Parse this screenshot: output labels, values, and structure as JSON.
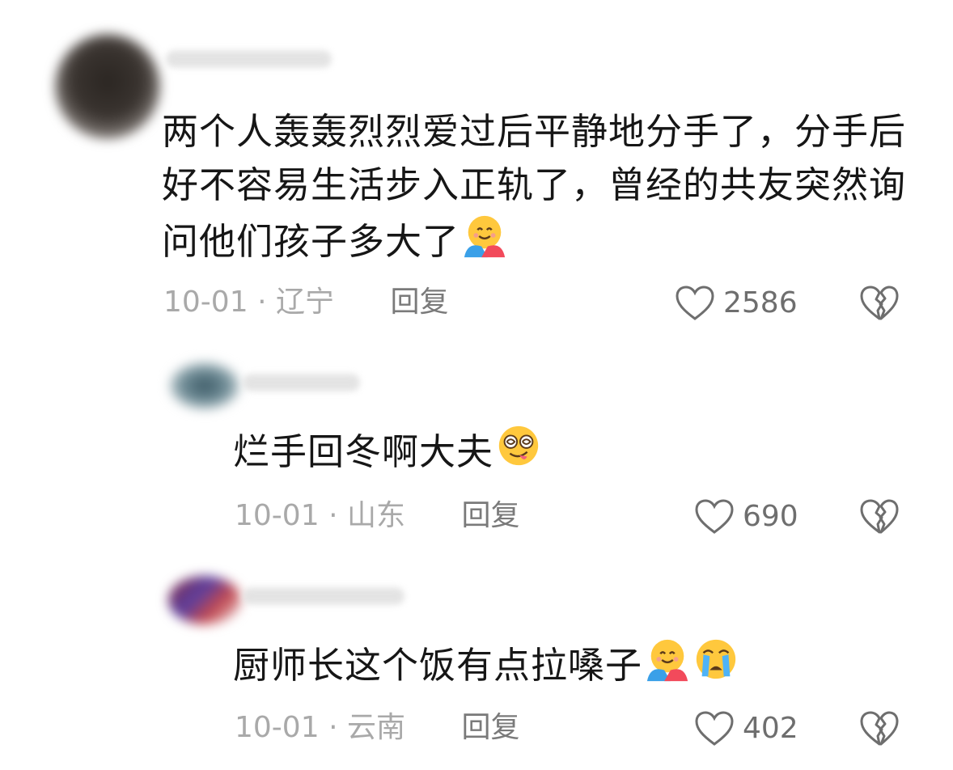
{
  "comments": [
    {
      "text": "两个人轰轰烈烈爱过后平静地分手了，分手后好不容易生活步入正轨了，曾经的共友突然询问他们孩子多大了",
      "emojis": [
        "smiling-face-with-hearts-hugging"
      ],
      "date": "10-01",
      "separator": "·",
      "location": "辽宁",
      "reply_label": "回复",
      "likes": "2586"
    },
    {
      "text": "烂手回冬啊大夫",
      "emojis": [
        "zany-face-with-dizzy-eyes"
      ],
      "date": "10-01",
      "separator": "·",
      "location": "山东",
      "reply_label": "回复",
      "likes": "690"
    },
    {
      "text": "厨师长这个饭有点拉嗓子",
      "emojis": [
        "smiling-face-with-hearts-hugging",
        "loudly-crying-face"
      ],
      "date": "10-01",
      "separator": "·",
      "location": "云南",
      "reply_label": "回复",
      "likes": "402"
    }
  ],
  "icons": {
    "like": "heart-outline-icon",
    "dislike": "broken-heart-icon"
  },
  "colors": {
    "text": "#161616",
    "meta": "#a9a9a9",
    "reply": "#7a7a7a",
    "icon": "#6e6e6e"
  }
}
